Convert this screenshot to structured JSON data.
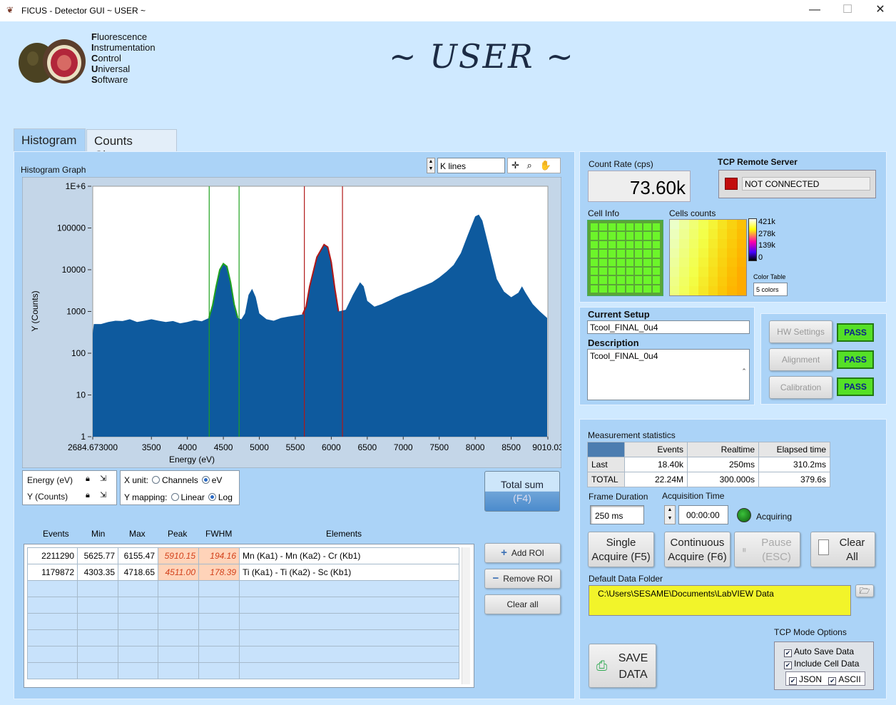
{
  "window": {
    "title": "FICUS - Detector GUI ~ USER ~",
    "min": "—",
    "max": "☐",
    "close": "✕"
  },
  "logo": {
    "lines": [
      {
        "i": "F",
        "r": "luorescence"
      },
      {
        "i": "I",
        "r": "nstrumentation"
      },
      {
        "i": "C",
        "r": "ontrol"
      },
      {
        "i": "U",
        "r": "niversal"
      },
      {
        "i": "S",
        "r": "oftware"
      }
    ]
  },
  "header_title": "~ USER ~",
  "tabs": [
    "Histogram",
    "Counts Charts"
  ],
  "histogram": {
    "graph_label": "Histogram Graph",
    "lines_select": "K lines",
    "xaxis_label": "Energy (eV)",
    "yaxis_label": "Y (Counts)",
    "energy_label": "Energy (eV)",
    "counts_label": "Y (Counts)",
    "xunit_label": "X unit:",
    "xunit_options": [
      "Channels",
      "eV"
    ],
    "ymap_label": "Y mapping:",
    "ymap_options": [
      "Linear",
      "Log"
    ],
    "total_sum": "Total sum",
    "total_sum_key": "(F4)"
  },
  "roi": {
    "headers": [
      "Events",
      "Min",
      "Max",
      "Peak",
      "FWHM",
      "Elements"
    ],
    "rows": [
      {
        "events": "2211290",
        "min": "5625.77",
        "max": "6155.47",
        "peak": "5910.15",
        "fwhm": "194.16",
        "elements": "Mn (Ka1) - Mn (Ka2) - Cr (Kb1)"
      },
      {
        "events": "1179872",
        "min": "4303.35",
        "max": "4718.65",
        "peak": "4511.00",
        "fwhm": "178.39",
        "elements": "Ti (Ka1) - Ti (Ka2) - Sc (Kb1)"
      }
    ],
    "add": "Add ROI",
    "remove": "Remove ROI",
    "clear": "Clear all"
  },
  "chart_data": {
    "type": "area",
    "yscale": "log",
    "x_tick_labels": [
      "2684.673000",
      "3500",
      "4000",
      "4500",
      "5000",
      "5500",
      "6000",
      "6500",
      "7000",
      "7500",
      "8000",
      "8500",
      "9010.03"
    ],
    "y_tick_labels": [
      "1E+6",
      "100000",
      "10000",
      "1000",
      "100",
      "10",
      "1"
    ],
    "xlabel": "Energy (eV)",
    "ylabel": "Y (Counts)",
    "xlim": [
      2684.673,
      9010.03
    ],
    "ylim": [
      1,
      1000000
    ],
    "points": [
      [
        2684.67,
        300
      ],
      [
        2700,
        500
      ],
      [
        2800,
        500
      ],
      [
        2900,
        560
      ],
      [
        3000,
        600
      ],
      [
        3100,
        590
      ],
      [
        3200,
        650
      ],
      [
        3300,
        560
      ],
      [
        3400,
        600
      ],
      [
        3500,
        650
      ],
      [
        3600,
        600
      ],
      [
        3700,
        560
      ],
      [
        3800,
        590
      ],
      [
        3900,
        520
      ],
      [
        4000,
        560
      ],
      [
        4100,
        620
      ],
      [
        4200,
        580
      ],
      [
        4300,
        700
      ],
      [
        4350,
        1400
      ],
      [
        4400,
        4000
      ],
      [
        4450,
        10000
      ],
      [
        4500,
        14000
      ],
      [
        4550,
        12000
      ],
      [
        4600,
        5000
      ],
      [
        4650,
        1500
      ],
      [
        4700,
        700
      ],
      [
        4750,
        650
      ],
      [
        4800,
        900
      ],
      [
        4850,
        2500
      ],
      [
        4900,
        3500
      ],
      [
        4950,
        2200
      ],
      [
        5000,
        900
      ],
      [
        5100,
        650
      ],
      [
        5200,
        600
      ],
      [
        5300,
        700
      ],
      [
        5400,
        750
      ],
      [
        5500,
        800
      ],
      [
        5600,
        850
      ],
      [
        5650,
        1300
      ],
      [
        5700,
        4000
      ],
      [
        5800,
        20000
      ],
      [
        5900,
        40000
      ],
      [
        5950,
        35000
      ],
      [
        6000,
        15000
      ],
      [
        6050,
        3500
      ],
      [
        6100,
        1000
      ],
      [
        6200,
        1100
      ],
      [
        6300,
        2500
      ],
      [
        6400,
        5000
      ],
      [
        6450,
        4000
      ],
      [
        6500,
        1800
      ],
      [
        6600,
        1300
      ],
      [
        6700,
        1500
      ],
      [
        6800,
        1800
      ],
      [
        6900,
        2200
      ],
      [
        7000,
        2600
      ],
      [
        7100,
        3000
      ],
      [
        7200,
        3600
      ],
      [
        7300,
        4200
      ],
      [
        7400,
        5000
      ],
      [
        7500,
        6500
      ],
      [
        7600,
        9000
      ],
      [
        7700,
        13000
      ],
      [
        7800,
        25000
      ],
      [
        7900,
        70000
      ],
      [
        8000,
        190000
      ],
      [
        8050,
        210000
      ],
      [
        8100,
        150000
      ],
      [
        8200,
        30000
      ],
      [
        8300,
        6000
      ],
      [
        8400,
        3000
      ],
      [
        8500,
        2200
      ],
      [
        8600,
        2800
      ],
      [
        8650,
        4000
      ],
      [
        8700,
        2800
      ],
      [
        8800,
        1500
      ],
      [
        8900,
        1000
      ],
      [
        9000,
        700
      ]
    ],
    "rois": [
      {
        "min": 4303.35,
        "max": 4718.65,
        "color": "#1fa21f"
      },
      {
        "min": 5625.77,
        "max": 6155.47,
        "color": "#b01818"
      }
    ]
  },
  "count_rate": {
    "label": "Count Rate (cps)",
    "value": "73.60k"
  },
  "tcp": {
    "label": "TCP Remote Server",
    "status": "NOT CONNECTED"
  },
  "cells": {
    "info_label": "Cell Info",
    "counts_label": "Cells counts",
    "scale_labels": [
      "421k",
      "278k",
      "139k",
      "0"
    ],
    "color_table_label": "Color Table",
    "color_table_value": "5 colors"
  },
  "setup": {
    "current_label": "Current Setup",
    "current_value": "Tcool_FINAL_0u4",
    "description_label": "Description",
    "description_value": "Tcool_FINAL_0u4"
  },
  "checks": [
    {
      "label": "HW Settings",
      "status": "PASS"
    },
    {
      "label": "Alignment",
      "status": "PASS"
    },
    {
      "label": "Calibration",
      "status": "PASS"
    }
  ],
  "measurement": {
    "label": "Measurement statistics",
    "headers": [
      "Events",
      "Realtime",
      "Elapsed time"
    ],
    "rows": [
      {
        "name": "Last",
        "events": "18.40k",
        "realtime": "250ms",
        "elapsed": "310.2ms"
      },
      {
        "name": "TOTAL",
        "events": "22.24M",
        "realtime": "300.000s",
        "elapsed": "379.6s"
      }
    ],
    "frame_label": "Frame Duration",
    "frame_value": "250 ms",
    "acq_label": "Acquisition Time",
    "acq_value": "00:00:00",
    "acquiring": "Acquiring"
  },
  "buttons": {
    "single": [
      "Single",
      "Acquire (F5)"
    ],
    "continuous": [
      "Continuous",
      "Acquire (F6)"
    ],
    "pause": [
      "Pause",
      "(ESC)"
    ],
    "clear": [
      "Clear",
      "All"
    ],
    "save": [
      "SAVE",
      "DATA"
    ]
  },
  "folder": {
    "label": "Default Data Folder",
    "value": "C:\\Users\\SESAME\\Documents\\LabVIEW Data"
  },
  "tcp_options": {
    "label": "TCP Mode Options",
    "auto_save": "Auto Save Data",
    "include_cell": "Include Cell Data",
    "json": "JSON",
    "ascii": "ASCII"
  }
}
